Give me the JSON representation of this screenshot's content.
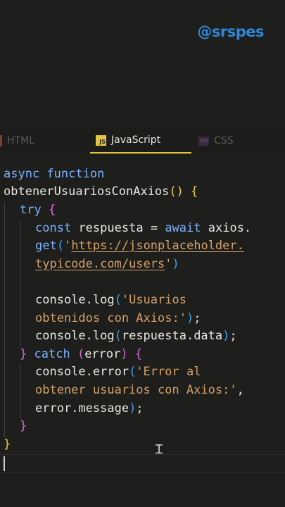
{
  "watermark": {
    "handle": "@srspes"
  },
  "tabs": [
    {
      "label": "HTML",
      "icon": "html-icon",
      "active": false
    },
    {
      "label": "JavaScript",
      "icon": "js-icon",
      "icon_text": "JS",
      "active": true
    },
    {
      "label": "CSS",
      "icon": "css-icon",
      "icon_text": "CSS",
      "active": false
    }
  ],
  "colors": {
    "keyword": "#7bb1ff",
    "string": "#d4a069",
    "paren_level1": "#f0c94a",
    "paren_level2": "#d46ad6",
    "paren_level3": "#3aa3f3",
    "active_tab_underline": "#e5c541"
  },
  "code": {
    "l1": {
      "kw1": "async",
      "kw2": "function"
    },
    "l2": {
      "name": "obtenerUsuariosConAxios",
      "open_paren": "(",
      "close_paren": ")",
      "brace": "{"
    },
    "l3": {
      "kw": "try",
      "brace": "{"
    },
    "l4": {
      "kw": "const",
      "var": "respuesta",
      "eq": "=",
      "kw2": "await",
      "obj": "axios."
    },
    "l5": {
      "method": "get",
      "paren": "(",
      "quote": "'",
      "url": "https://jsonplaceholder."
    },
    "l6": {
      "url": "typicode.com/users",
      "quote": "'",
      "paren": ")"
    },
    "l7": {
      "call": "console.log",
      "paren": "(",
      "str": "'Usuarios"
    },
    "l8": {
      "str": "obtenidos con Axios:'",
      "rest": ";"
    },
    "l9": {
      "call": "console.log",
      "paren": "(",
      "arg": "respuesta.data",
      "close": ")",
      "rest": ";"
    },
    "l10": {
      "brace": "}",
      "kw": "catch",
      "paren": "(",
      "arg": "error",
      "close": ")",
      "brace2": "{"
    },
    "l11": {
      "call": "console.error",
      "paren": "(",
      "str": "'Error al"
    },
    "l12": {
      "str": "obtener usuarios con Axios:'",
      "rest": ","
    },
    "l13": {
      "arg": "error.message",
      "close": ")",
      "rest": ";"
    },
    "l14": {
      "brace": "}"
    },
    "l15": {
      "brace": "}"
    }
  }
}
